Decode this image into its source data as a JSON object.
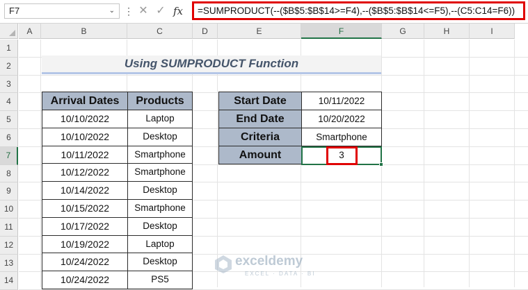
{
  "formula_bar": {
    "name_box": "F7",
    "name_box_dropdown_icon": "chevron-down-icon",
    "dots": "⋮",
    "cancel_glyph": "✕",
    "enter_glyph": "✓",
    "fx_glyph": "fx",
    "formula": "=SUMPRODUCT(--($B$5:$B$14>=F4),--($B$5:$B$14<=F5),--(C5:C14=F6))"
  },
  "columns": [
    "A",
    "B",
    "C",
    "D",
    "E",
    "F",
    "G",
    "H",
    "I"
  ],
  "rows": [
    "1",
    "2",
    "3",
    "4",
    "5",
    "6",
    "7",
    "8",
    "9",
    "10",
    "11",
    "12",
    "13",
    "14"
  ],
  "selected_cell": {
    "column": "F",
    "row": "7"
  },
  "title": "Using SUMPRODUCT Function",
  "data_table": {
    "headers": [
      "Arrival Dates",
      "Products"
    ],
    "rows": [
      [
        "10/10/2022",
        "Laptop"
      ],
      [
        "10/10/2022",
        "Desktop"
      ],
      [
        "10/11/2022",
        "Smartphone"
      ],
      [
        "10/12/2022",
        "Smartphone"
      ],
      [
        "10/14/2022",
        "Desktop"
      ],
      [
        "10/15/2022",
        "Smartphone"
      ],
      [
        "10/17/2022",
        "Desktop"
      ],
      [
        "10/19/2022",
        "Laptop"
      ],
      [
        "10/24/2022",
        "Desktop"
      ],
      [
        "10/24/2022",
        "PS5"
      ]
    ]
  },
  "criteria_table": {
    "rows": [
      {
        "label": "Start Date",
        "value": "10/11/2022"
      },
      {
        "label": "End Date",
        "value": "10/20/2022"
      },
      {
        "label": "Criteria",
        "value": "Smartphone"
      },
      {
        "label": "Amount",
        "value": "3"
      }
    ]
  },
  "watermark": {
    "name": "exceldemy",
    "tagline": "EXCEL · DATA · BI"
  },
  "colors": {
    "header_fill": "#adb9ca",
    "highlight_red": "#e00000",
    "excel_green": "#217346"
  }
}
